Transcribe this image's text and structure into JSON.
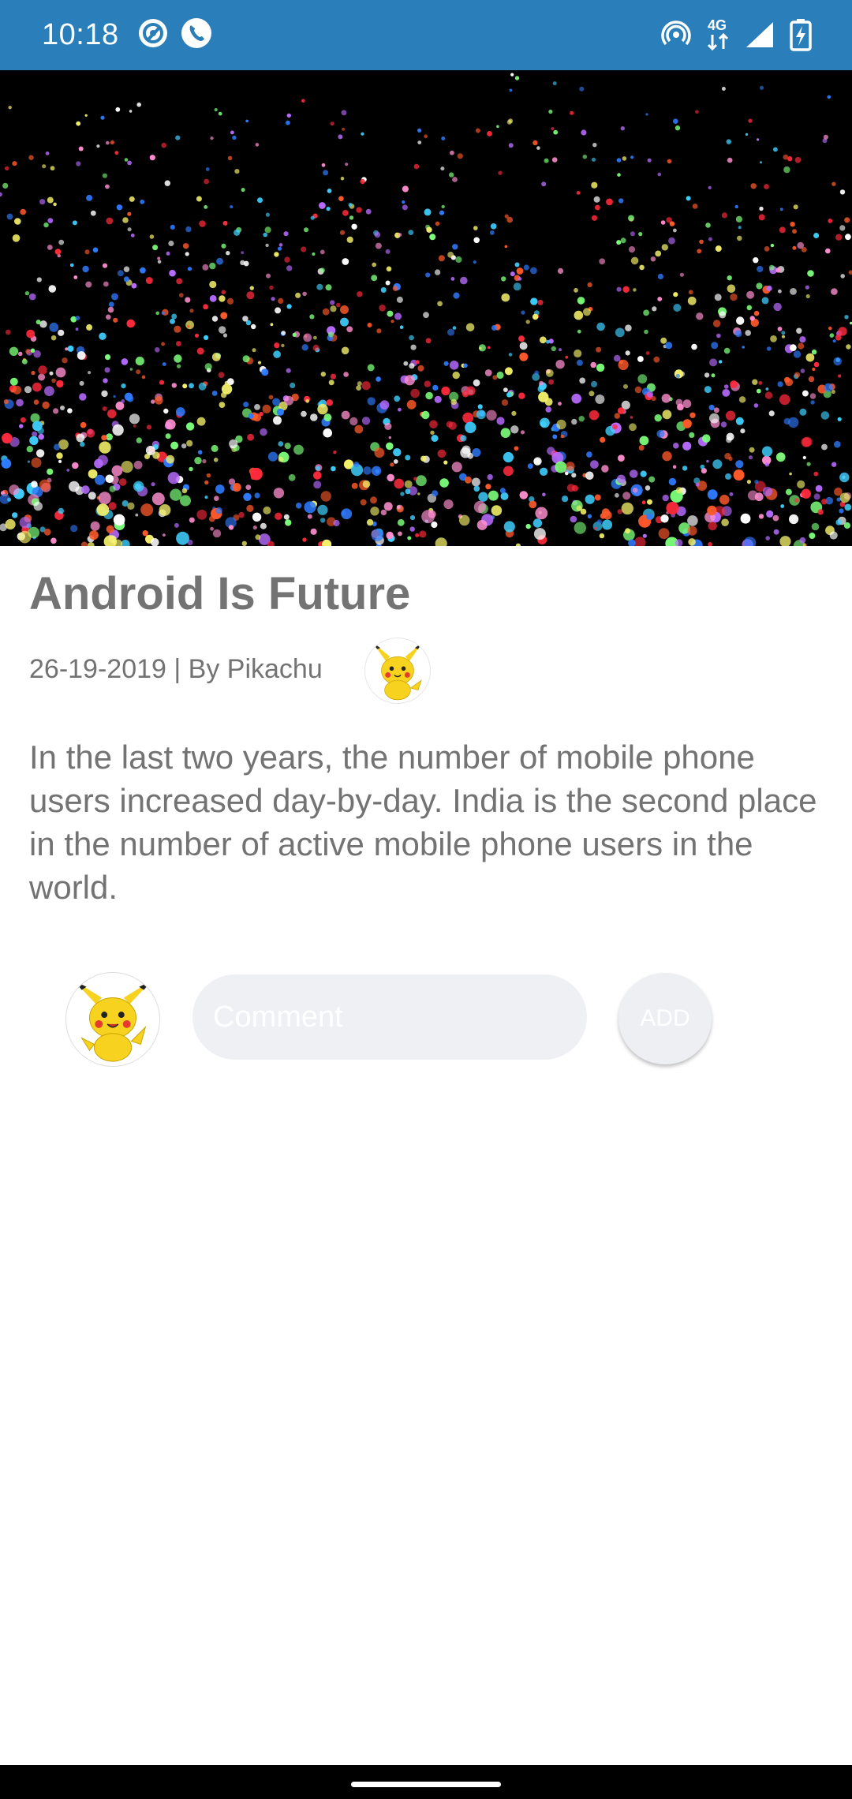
{
  "status_bar": {
    "time": "10:18",
    "network_label": "4G",
    "icons": [
      "at-sign-icon",
      "phone-call-icon",
      "hotspot-icon",
      "network-4g-icon",
      "signal-icon",
      "battery-charging-icon"
    ],
    "background": "#2a7fba"
  },
  "article": {
    "title": "Android Is Future",
    "meta": "26-19-2019 | By Pikachu",
    "body": "In the last two years, the number of mobile phone users increased day-by-day. India is the second place in the number of active mobile phone users in the world."
  },
  "comment": {
    "placeholder": "Comment",
    "value": "",
    "add_label": "ADD"
  },
  "colors": {
    "text_gray": "#737373",
    "input_bg": "#eff0f3",
    "hero_bg": "#000000"
  }
}
